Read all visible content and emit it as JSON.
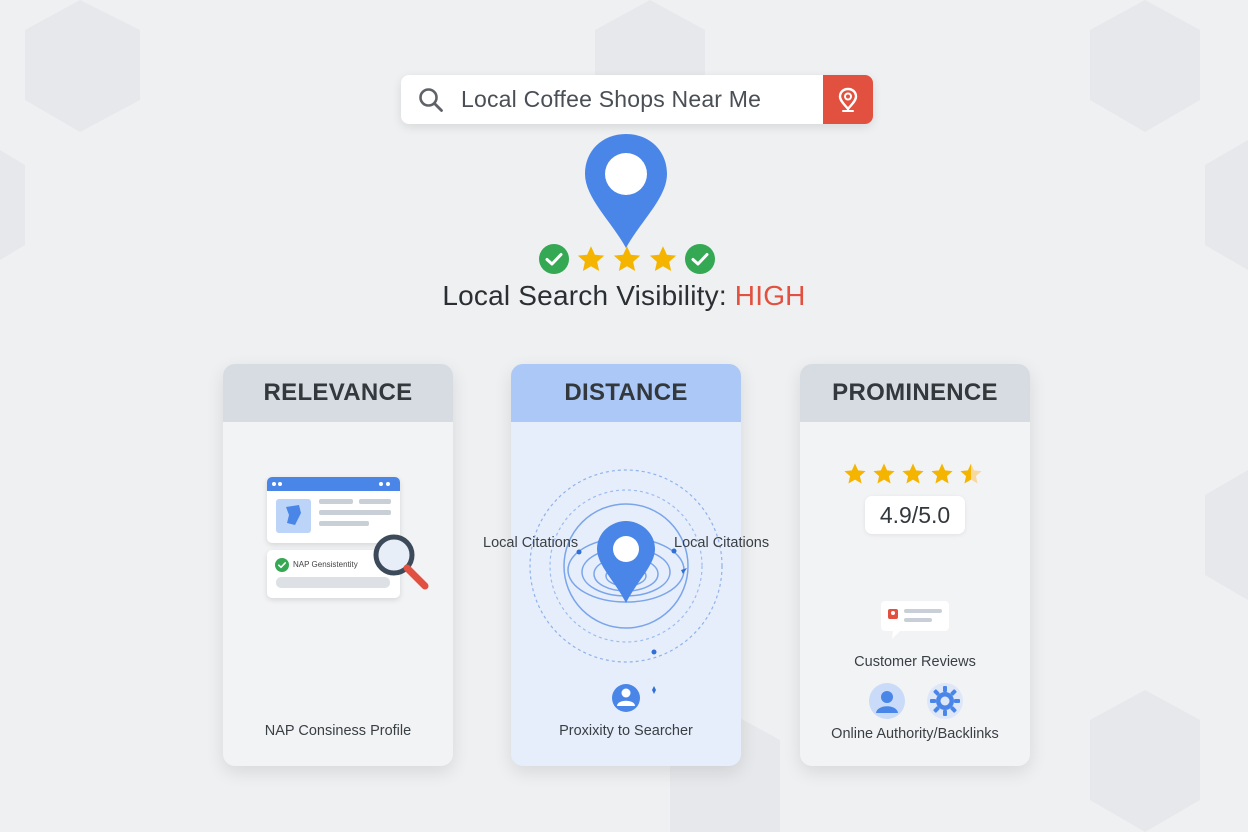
{
  "search": {
    "query": "Local Coffee Shops Near Me"
  },
  "headline": {
    "label": "Local Search Visibility:",
    "value": "HIGH"
  },
  "cards": {
    "relevance": {
      "title": "RELEVANCE",
      "nap_label": "NAP Gensistentity",
      "caption": "NAP Consiness Profile"
    },
    "distance": {
      "title": "DISTANCE",
      "left_label": "Local Citations",
      "right_label": "Local Citations",
      "caption": "Proxixity to Searcher"
    },
    "prominence": {
      "title": "PROMINENCE",
      "stars": 4.5,
      "score": "4.9/5.0",
      "reviews_caption": "Customer Reviews",
      "authority_caption": "Online Authority/Backlinks"
    }
  },
  "colors": {
    "brand_blue": "#4a86e8",
    "accent_red": "#e2503f",
    "star": "#f4b400",
    "check": "#34a853"
  }
}
